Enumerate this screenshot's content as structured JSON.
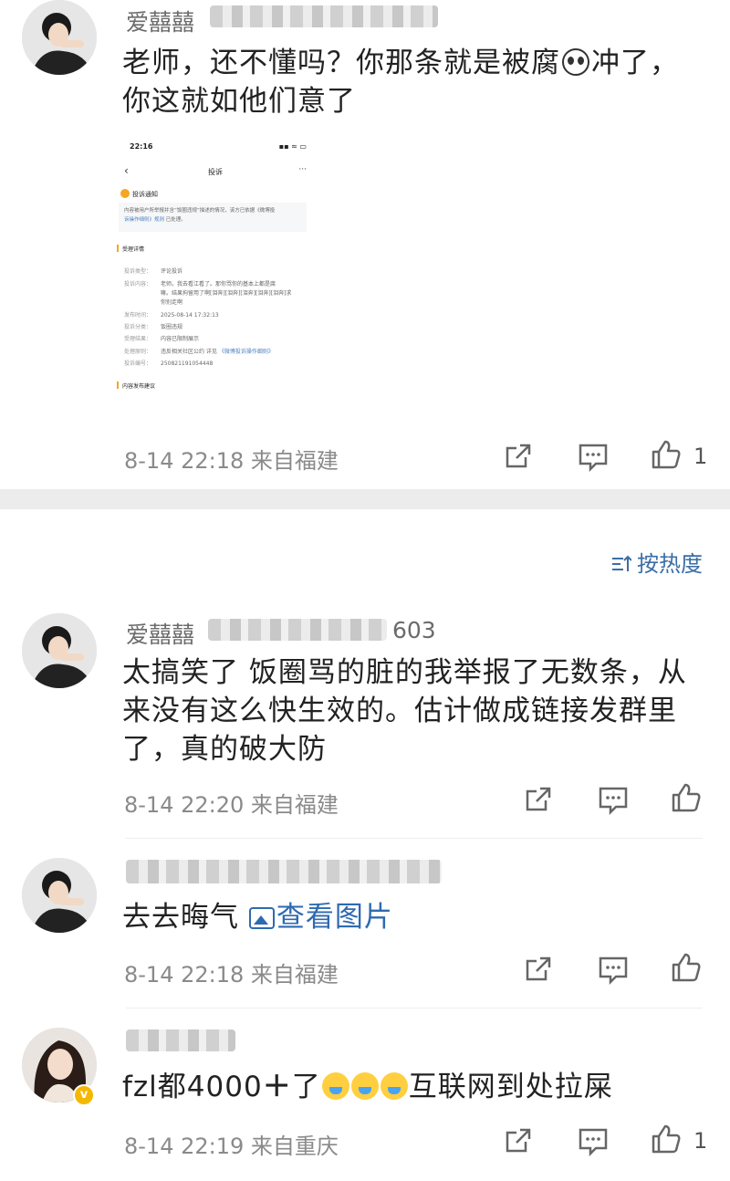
{
  "comments": [
    {
      "username": "爱囍囍",
      "text_line1_before": "老师，还不懂吗？你那条就是被腐",
      "text_line1_after": "冲了，",
      "text_line2": "你这就如他们意了",
      "emoji": "panda-emoji",
      "time": "8-14 22:18",
      "location": "来自福建",
      "likes": "1"
    },
    {
      "username": "爱囍囍",
      "username_tail": "603",
      "text_line1": "太搞笑了 饭圈骂的脏的我举报了无数条，从",
      "text_line2": "来没有这么快生效的。估计做成链接发群里",
      "text_line3": "了，真的破大防",
      "time": "8-14 22:20",
      "location": "来自福建",
      "likes": ""
    },
    {
      "username": "",
      "text": "去去晦气",
      "image_link": "查看图片",
      "time": "8-14 22:18",
      "location": "来自福建",
      "likes": ""
    },
    {
      "username": "",
      "text_before": "fzl都4000",
      "text_plus": "＋",
      "text_mid": "了",
      "text_after": "互联网到处拉屎",
      "emoji": "crying-emoji",
      "time": "8-14 22:19",
      "location": "来自重庆",
      "likes": "1"
    }
  ],
  "sort_label": "按热度",
  "embedded_screenshot": {
    "status_time": "22:16",
    "title": "投诉",
    "notice_title": "投诉通知",
    "notice_text_1": "内容被用户所举报并含“饭圈违规”描述的情况，该方已依据《微博投",
    "notice_text_2": "诉操作细则》规则",
    "notice_text_3": "已处理。",
    "section_title": "受理详情",
    "rows": [
      {
        "label": "投诉类型：",
        "value": "评论投诉"
      },
      {
        "label": "投诉内容：",
        "value": "老师。我去看江看了。那你骂你的基本上都是腐"
      },
      {
        "label": "",
        "value": "嘛。结果拘留用了啊[泪奔][泪奔][泪奔][泪奔][泪奔]求"
      },
      {
        "label": "",
        "value": "你别走啊"
      },
      {
        "label": "发布时间：",
        "value": "2025-08-14 17:32:13"
      },
      {
        "label": "投诉分类：",
        "value": "饭圈违规"
      },
      {
        "label": "受理结果：",
        "value": "内容已限制展示"
      },
      {
        "label": "处理原则：",
        "value": "违反相关社区公约 详见",
        "link": "《微博投诉操作细则》"
      },
      {
        "label": "投诉编号：",
        "value": "250821191054448"
      }
    ],
    "footer_title": "内容发布建议"
  },
  "colors": {
    "link": "#2e6ab0",
    "meta": "#8a8a8a",
    "divider": "#ececec"
  }
}
